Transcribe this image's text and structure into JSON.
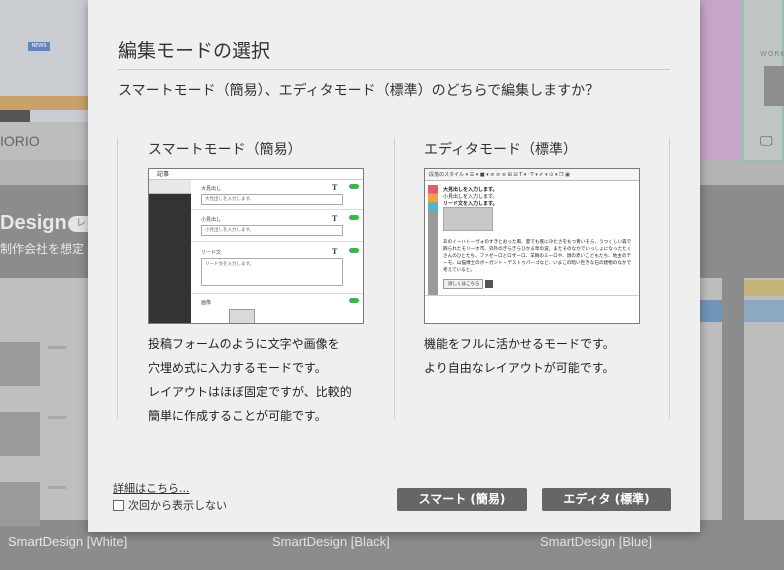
{
  "background": {
    "top_card_label": "IORIO",
    "news_badge": "NEWS",
    "design_heading": "Design",
    "design_badge": "レ",
    "design_sub": "制作会社を想定",
    "right_card_label": "WORKS",
    "captions": [
      "SmartDesign [White]",
      "SmartDesign [Black]",
      "SmartDesign [Blue]"
    ]
  },
  "modal": {
    "title": "編集モードの選択",
    "question": "スマートモード（簡易）、エディタモード（標準）のどちらで編集しますか？",
    "smart": {
      "title": "スマートモード（簡易）",
      "preview": {
        "header": "記事",
        "fields": [
          {
            "label": "大見出し",
            "placeholder": "大見出しを入力します。"
          },
          {
            "label": "小見出し",
            "placeholder": "小見出しを入力します。"
          },
          {
            "label": "リード文",
            "placeholder": "リード文を入力します。"
          },
          {
            "label": "画像",
            "placeholder": ""
          }
        ]
      },
      "description": [
        "投稿フォームのように文字や画像を",
        "穴埋め式に入力するモードです。",
        "レイアウトはほぼ固定ですが、比較的",
        "簡単に作成することが可能です。"
      ]
    },
    "editor": {
      "title": "エディタモード（標準）",
      "preview": {
        "toolbar": "段落のスタイル ▾  ☰ ▾  ■ ▾  ≡ ≡ ≡  ⊞ ⊟  T ▾  ⁻T ▾  ✐ ▾  ⊙ ▾  ❐  ▣",
        "line1": "大見出しを入力します。",
        "line2": "小見出しを入力します。",
        "line3": "リード文を入力します。",
        "paragraph": "あのイーハトーヴォのすきとおった風、夏でも底に冷たさをもつ青いそら、うつくしい森で飾られたモリーオ市、郊外のぎらぎらひかる草の波。またそのなかでいっしょになったたくさんのひとたち、ファゼーロとロザーロ、羊飼のミーロや、顔の赤いこどもたち、地主のテーモ、山猫博士のボーガント・デストゥパーゴなど、いまこの暗い巨きな石の建物のなかで考えていると。",
        "button": "詳しくはこちら"
      },
      "description": [
        "機能をフルに活かせるモードです。",
        "より自由なレイアウトが可能です。"
      ]
    },
    "detail_link": "詳細はこちら...",
    "dont_show": "次回から表示しない",
    "smart_button": "スマート (簡易)",
    "editor_button": "エディタ (標準)"
  }
}
